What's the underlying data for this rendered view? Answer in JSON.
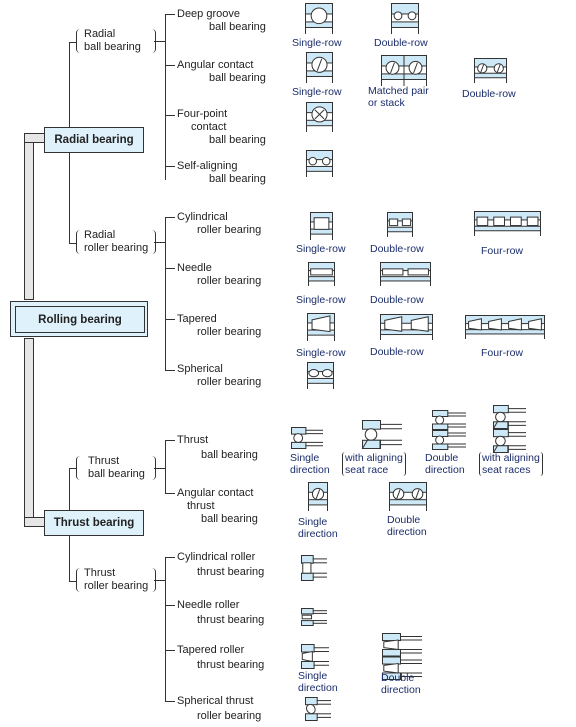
{
  "colors": {
    "fill": "#cde8f6",
    "line": "#333333",
    "caption": "#1b2d6b",
    "box": "#dff1fa"
  },
  "root": "Rolling bearing",
  "radial": {
    "title": "Radial bearing",
    "ball": {
      "l1": "Radial",
      "l2": "ball bearing",
      "items": [
        {
          "l1": "Deep groove",
          "l2": "ball bearing"
        },
        {
          "l1": "Angular contact",
          "l2": "ball bearing"
        },
        {
          "l1": "Four-point",
          "l2": "contact",
          "l3": "ball bearing"
        },
        {
          "l1": "Self-aligning",
          "l2": "ball bearing"
        }
      ]
    },
    "roller": {
      "l1": "Radial",
      "l2": "roller bearing",
      "items": [
        {
          "l1": "Cylindrical",
          "l2": "roller bearing"
        },
        {
          "l1": "Needle",
          "l2": "roller bearing"
        },
        {
          "l1": "Tapered",
          "l2": "roller bearing"
        },
        {
          "l1": "Spherical",
          "l2": "roller bearing"
        }
      ]
    }
  },
  "thrust": {
    "title": "Thrust bearing",
    "ball": {
      "l1": "Thrust",
      "l2": "ball bearing",
      "items": [
        {
          "l1": "Thrust",
          "l2": "ball bearing"
        },
        {
          "l1": "Angular contact",
          "l2": "thrust",
          "l3": "ball bearing"
        }
      ]
    },
    "roller": {
      "l1": "Thrust",
      "l2": "roller bearing",
      "items": [
        {
          "l1": "Cylindrical roller",
          "l2": "thrust bearing"
        },
        {
          "l1": "Needle roller",
          "l2": "thrust bearing"
        },
        {
          "l1": "Tapered roller",
          "l2": "thrust bearing"
        },
        {
          "l1": "Spherical thrust",
          "l2": "roller bearing"
        }
      ]
    }
  },
  "icons": {
    "deep_single": {
      "kind": "radial-ball",
      "n": 1,
      "c1": "Single-row"
    },
    "deep_double": {
      "kind": "radial-ball",
      "n": 2,
      "c1": "Double-row"
    },
    "ang_single": {
      "kind": "radial-angular",
      "n": 1,
      "c1": "Single-row"
    },
    "ang_pair": {
      "kind": "radial-angular-pair",
      "n": 2,
      "c1": "Matched pair",
      "c2": "or stack"
    },
    "ang_double": {
      "kind": "radial-angular",
      "n": 2,
      "c1": "Double-row"
    },
    "four_point": {
      "kind": "radial-fourpoint",
      "n": 1
    },
    "self_align": {
      "kind": "radial-ball",
      "n": 2
    },
    "cyl_single": {
      "kind": "radial-roller",
      "n": 1,
      "c1": "Single-row"
    },
    "cyl_double": {
      "kind": "radial-roller",
      "n": 2,
      "c1": "Double-row"
    },
    "cyl_four": {
      "kind": "radial-roller",
      "n": 4,
      "c1": "Four-row"
    },
    "needle_single": {
      "kind": "radial-needle",
      "n": 1,
      "c1": "Single-row"
    },
    "needle_double": {
      "kind": "radial-needle",
      "n": 2,
      "c1": "Double-row"
    },
    "taper_single": {
      "kind": "radial-tapered",
      "n": 1,
      "c1": "Single-row"
    },
    "taper_double": {
      "kind": "radial-tapered",
      "n": 2,
      "c1": "Double-row"
    },
    "taper_four": {
      "kind": "radial-tapered",
      "n": 4,
      "c1": "Four-row"
    },
    "spherical": {
      "kind": "radial-spherical",
      "n": 2
    },
    "tb_single": {
      "kind": "thrust-ball",
      "n": 1,
      "c1": "Single",
      "c2": "direction"
    },
    "tb_align": {
      "kind": "thrust-ball-aligning",
      "n": 1,
      "c1": "with aligning",
      "c2": "seat race"
    },
    "tb_double": {
      "kind": "thrust-ball",
      "n": 2,
      "c1": "Double",
      "c2": "direction"
    },
    "tb_double_align": {
      "kind": "thrust-ball-aligning",
      "n": 2,
      "c1": "with aligning",
      "c2": "seat races"
    },
    "atb_single": {
      "kind": "radial-angular",
      "n": 1,
      "c1": "Single",
      "c2": "direction"
    },
    "atb_double": {
      "kind": "radial-angular",
      "n": 2,
      "c1": "Double",
      "c2": "direction"
    },
    "cyl_thrust": {
      "kind": "thrust-roller",
      "n": 1
    },
    "needle_thrust": {
      "kind": "thrust-needle",
      "n": 1
    },
    "taper_thrust_single": {
      "kind": "thrust-tapered",
      "n": 1,
      "c1": "Single",
      "c2": "direction"
    },
    "taper_thrust_double": {
      "kind": "thrust-tapered",
      "n": 2,
      "c1": "Double",
      "c2": "direction"
    },
    "sph_thrust": {
      "kind": "thrust-spherical",
      "n": 1
    }
  }
}
